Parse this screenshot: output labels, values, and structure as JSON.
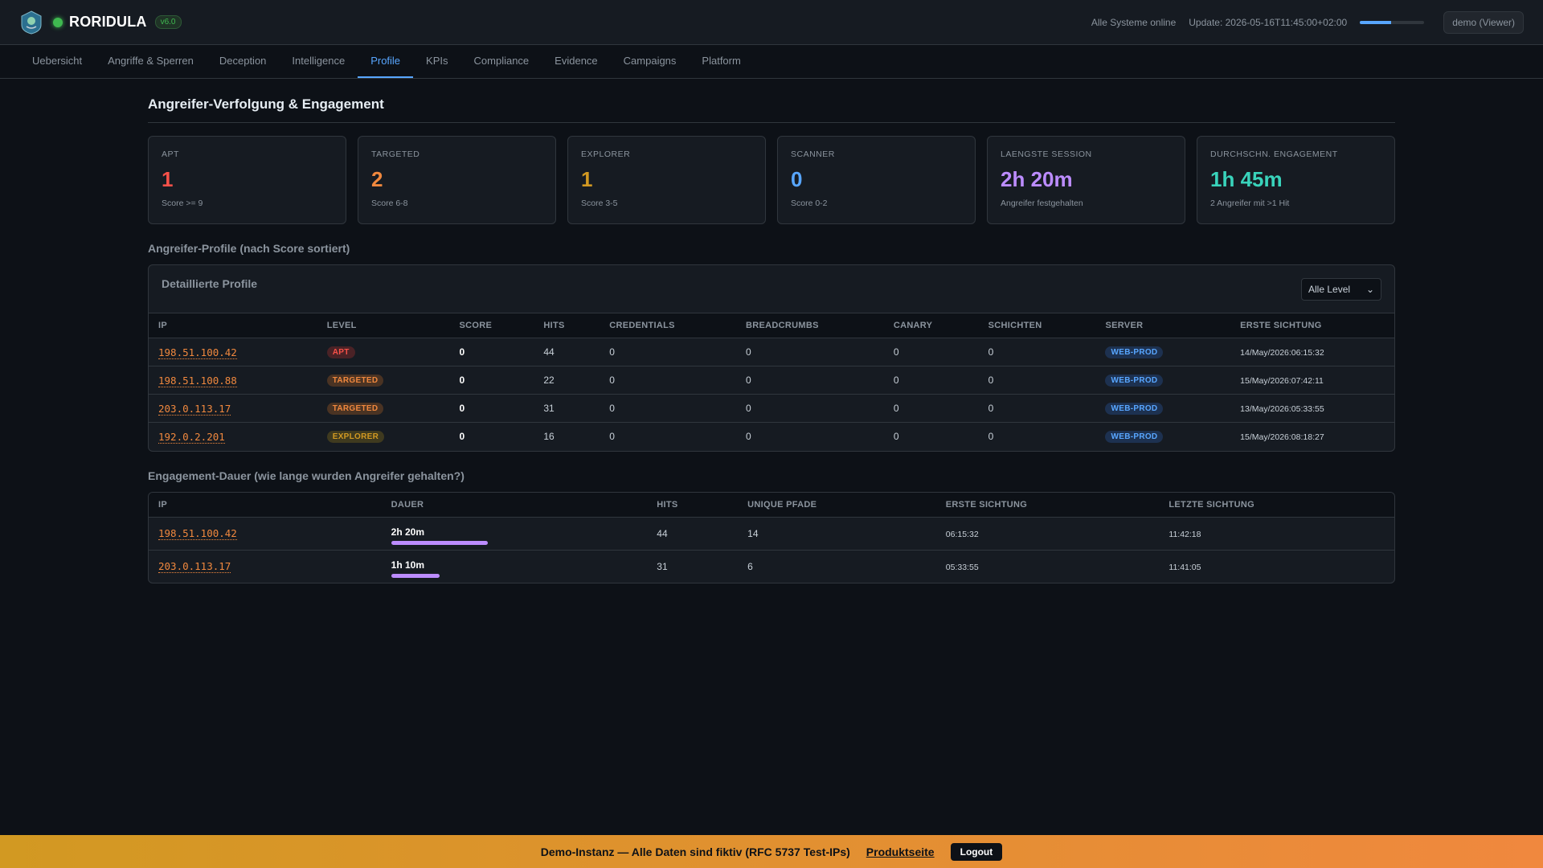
{
  "header": {
    "brand": "RORIDULA",
    "version": "v6.0",
    "status_text": "Alle Systeme online",
    "update_text": "Update: 2026-05-16T11:45:00+02:00",
    "user": "demo (Viewer)",
    "refresh_progress": 0.48
  },
  "nav": {
    "tabs": [
      "Uebersicht",
      "Angriffe & Sperren",
      "Deception",
      "Intelligence",
      "Profile",
      "KPIs",
      "Compliance",
      "Evidence",
      "Campaigns",
      "Platform"
    ],
    "active": "Profile"
  },
  "page_title": "Angreifer-Verfolgung & Engagement",
  "kpis": [
    {
      "label": "APT",
      "value": "1",
      "sub": "Score >= 9",
      "color": "#f85149"
    },
    {
      "label": "TARGETED",
      "value": "2",
      "sub": "Score 6-8",
      "color": "#f0883e"
    },
    {
      "label": "EXPLORER",
      "value": "1",
      "sub": "Score 3-5",
      "color": "#d29922"
    },
    {
      "label": "SCANNER",
      "value": "0",
      "sub": "Score 0-2",
      "color": "#58a6ff"
    },
    {
      "label": "LAENGSTE SESSION",
      "value": "2h 20m",
      "sub": "Angreifer festgehalten",
      "color": "#bc8cff"
    },
    {
      "label": "DURCHSCHN. ENGAGEMENT",
      "value": "1h 45m",
      "sub": "2 Angreifer mit >1 Hit",
      "color": "#39d3bb"
    }
  ],
  "profiles": {
    "section_title": "Angreifer-Profile (nach Score sortiert)",
    "panel_title": "Detaillierte Profile",
    "filter_value": "Alle Level",
    "columns": [
      "IP",
      "LEVEL",
      "SCORE",
      "HITS",
      "CREDENTIALS",
      "BREADCRUMBS",
      "CANARY",
      "SCHICHTEN",
      "SERVER",
      "ERSTE SICHTUNG"
    ],
    "rows": [
      {
        "ip": "198.51.100.42",
        "level": "APT",
        "score": "0",
        "hits": "44",
        "credentials": "0",
        "breadcrumbs": "0",
        "canary": "0",
        "schichten": "0",
        "server": "WEB-PROD",
        "first_seen": "14/May/2026:06:15:32"
      },
      {
        "ip": "198.51.100.88",
        "level": "TARGETED",
        "score": "0",
        "hits": "22",
        "credentials": "0",
        "breadcrumbs": "0",
        "canary": "0",
        "schichten": "0",
        "server": "WEB-PROD",
        "first_seen": "15/May/2026:07:42:11"
      },
      {
        "ip": "203.0.113.17",
        "level": "TARGETED",
        "score": "0",
        "hits": "31",
        "credentials": "0",
        "breadcrumbs": "0",
        "canary": "0",
        "schichten": "0",
        "server": "WEB-PROD",
        "first_seen": "13/May/2026:05:33:55"
      },
      {
        "ip": "192.0.2.201",
        "level": "EXPLORER",
        "score": "0",
        "hits": "16",
        "credentials": "0",
        "breadcrumbs": "0",
        "canary": "0",
        "schichten": "0",
        "server": "WEB-PROD",
        "first_seen": "15/May/2026:08:18:27"
      }
    ]
  },
  "engagement": {
    "section_title": "Engagement-Dauer (wie lange wurden Angreifer gehalten?)",
    "columns": [
      "IP",
      "DAUER",
      "HITS",
      "UNIQUE PFADE",
      "ERSTE SICHTUNG",
      "LETZTE SICHTUNG"
    ],
    "rows": [
      {
        "ip": "198.51.100.42",
        "duration": "2h 20m",
        "duration_fraction": 1.0,
        "hits": "44",
        "unique_paths": "14",
        "first_seen": "06:15:32",
        "last_seen": "11:42:18"
      },
      {
        "ip": "203.0.113.17",
        "duration": "1h 10m",
        "duration_fraction": 0.5,
        "hits": "31",
        "unique_paths": "6",
        "first_seen": "05:33:55",
        "last_seen": "11:41:05"
      }
    ]
  },
  "banner": {
    "text": "Demo-Instanz — Alle Daten sind fiktiv (RFC 5737 Test-IPs)",
    "link": "Produktseite",
    "logout": "Logout"
  }
}
